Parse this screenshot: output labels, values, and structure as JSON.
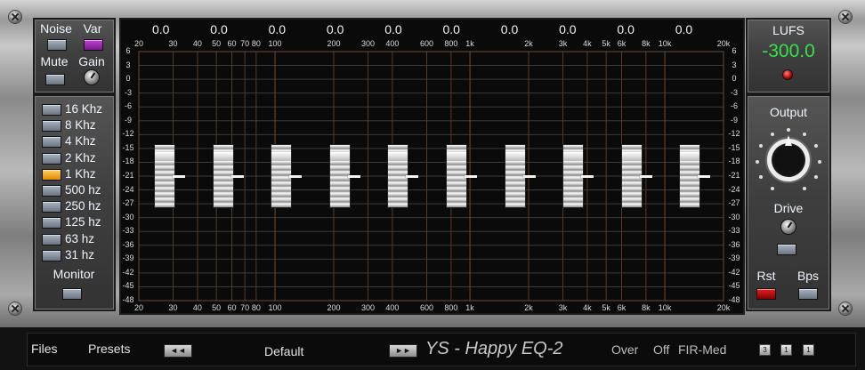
{
  "left_panel": {
    "noise_label": "Noise",
    "var_label": "Var",
    "mute_label": "Mute",
    "gain_label": "Gain",
    "monitor_label": "Monitor",
    "freq_buttons": [
      {
        "label": "16 Khz",
        "active": false
      },
      {
        "label": "8 Khz",
        "active": false
      },
      {
        "label": "4 Khz",
        "active": false
      },
      {
        "label": "2 Khz",
        "active": false
      },
      {
        "label": "1 Khz",
        "active": true
      },
      {
        "label": "500 hz",
        "active": false
      },
      {
        "label": "250 hz",
        "active": false
      },
      {
        "label": "125 hz",
        "active": false
      },
      {
        "label": "63 hz",
        "active": false
      },
      {
        "label": "31 hz",
        "active": false
      }
    ]
  },
  "graph": {
    "band_values": [
      "0.0",
      "0.0",
      "0.0",
      "0.0",
      "0.0",
      "0.0",
      "0.0",
      "0.0",
      "0.0",
      "0.0"
    ],
    "freq_ticks": [
      {
        "label": "20",
        "hz": 20
      },
      {
        "label": "30",
        "hz": 30
      },
      {
        "label": "40",
        "hz": 40
      },
      {
        "label": "50",
        "hz": 50
      },
      {
        "label": "60",
        "hz": 60
      },
      {
        "label": "70",
        "hz": 70
      },
      {
        "label": "80",
        "hz": 80
      },
      {
        "label": "100",
        "hz": 100
      },
      {
        "label": "200",
        "hz": 200
      },
      {
        "label": "300",
        "hz": 300
      },
      {
        "label": "400",
        "hz": 400
      },
      {
        "label": "600",
        "hz": 600
      },
      {
        "label": "800",
        "hz": 800
      },
      {
        "label": "1k",
        "hz": 1000
      },
      {
        "label": "2k",
        "hz": 2000
      },
      {
        "label": "3k",
        "hz": 3000
      },
      {
        "label": "4k",
        "hz": 4000
      },
      {
        "label": "5k",
        "hz": 5000
      },
      {
        "label": "6k",
        "hz": 6000
      },
      {
        "label": "8k",
        "hz": 8000
      },
      {
        "label": "10k",
        "hz": 10000
      },
      {
        "label": "20k",
        "hz": 20000
      }
    ],
    "db_ticks": [
      "6",
      "3",
      "0",
      "-3",
      "-6",
      "-9",
      "-12",
      "-15",
      "-18",
      "-21",
      "-24",
      "-27",
      "-30",
      "-33",
      "-36",
      "-39",
      "-42",
      "-45",
      "-48"
    ],
    "faders": [
      {
        "band": "31 hz",
        "gain_db": 0.0
      },
      {
        "band": "63 hz",
        "gain_db": 0.0
      },
      {
        "band": "125 hz",
        "gain_db": 0.0
      },
      {
        "band": "250 hz",
        "gain_db": 0.0
      },
      {
        "band": "500 hz",
        "gain_db": 0.0
      },
      {
        "band": "1 Khz",
        "gain_db": 0.0
      },
      {
        "band": "2 Khz",
        "gain_db": 0.0
      },
      {
        "band": "4 Khz",
        "gain_db": 0.0
      },
      {
        "band": "8 Khz",
        "gain_db": 0.0
      },
      {
        "band": "16 Khz",
        "gain_db": 0.0
      }
    ]
  },
  "right_panel": {
    "lufs_label": "LUFS",
    "lufs_value": "-300.0",
    "output_label": "Output",
    "drive_label": "Drive",
    "rst_label": "Rst",
    "bps_label": "Bps",
    "lufs_color": "#36e14a"
  },
  "bottom_bar": {
    "files_label": "Files",
    "presets_label": "Presets",
    "prev_label": "◄◄",
    "preset_name": "Default",
    "next_label": "►►",
    "title": "YS - Happy EQ-2",
    "over_label": "Over",
    "off_label": "Off",
    "fir_label": "FIR-Med",
    "mode_buttons": [
      "3",
      "1",
      "1"
    ]
  }
}
